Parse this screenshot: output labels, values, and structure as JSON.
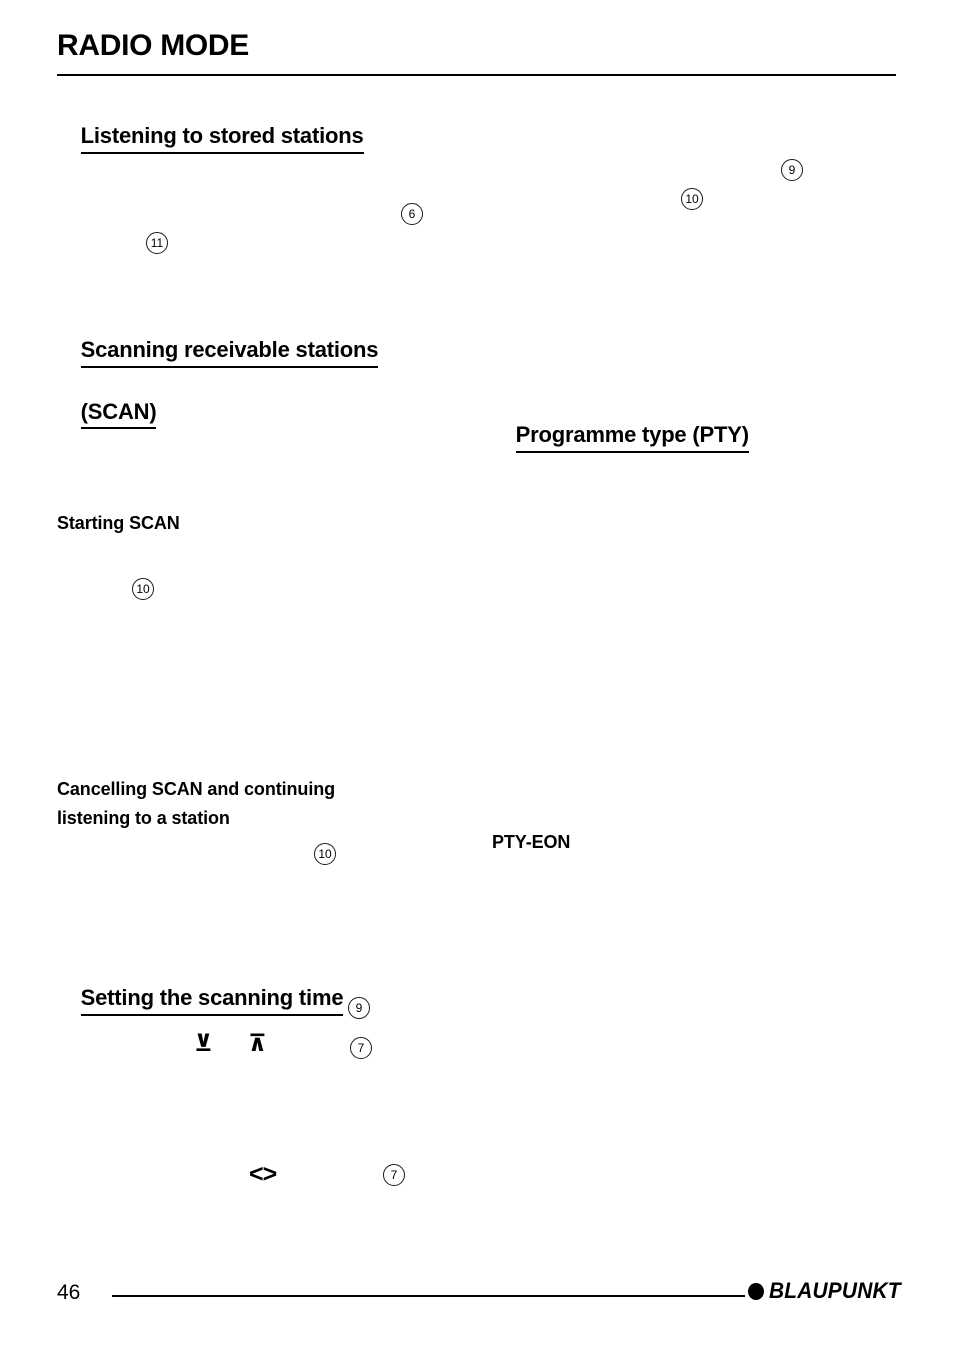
{
  "document": {
    "chapter_title": "RADIO MODE"
  },
  "headings": {
    "listening_stored": "Listening to stored stations",
    "scanning_line1": "Scanning receivable stations",
    "scanning_line2": "(SCAN)",
    "programme_type": "Programme type (PTY)",
    "setting_scanning_time": "Setting the scanning time"
  },
  "subheadings": {
    "starting_scan": "Starting SCAN",
    "cancelling_scan_line1": "Cancelling SCAN and continuing",
    "cancelling_scan_line2": "listening to a station",
    "pty_eon": "PTY-EON"
  },
  "markers": {
    "m_nine_top": "9",
    "m_ten_top": "10",
    "m_six": "6",
    "m_eleven": "11",
    "m_ten_starting_scan": "10",
    "m_ten_cancelling": "10",
    "m_nine_time": "9",
    "m_seven_time": "7",
    "m_seven_bottom": "7"
  },
  "glyphs": {
    "arrow_down": "⊻",
    "arrow_up": "⊼",
    "left_right": "<>"
  },
  "footer": {
    "page_number": "46",
    "brand": "BLAUPUNKT"
  }
}
